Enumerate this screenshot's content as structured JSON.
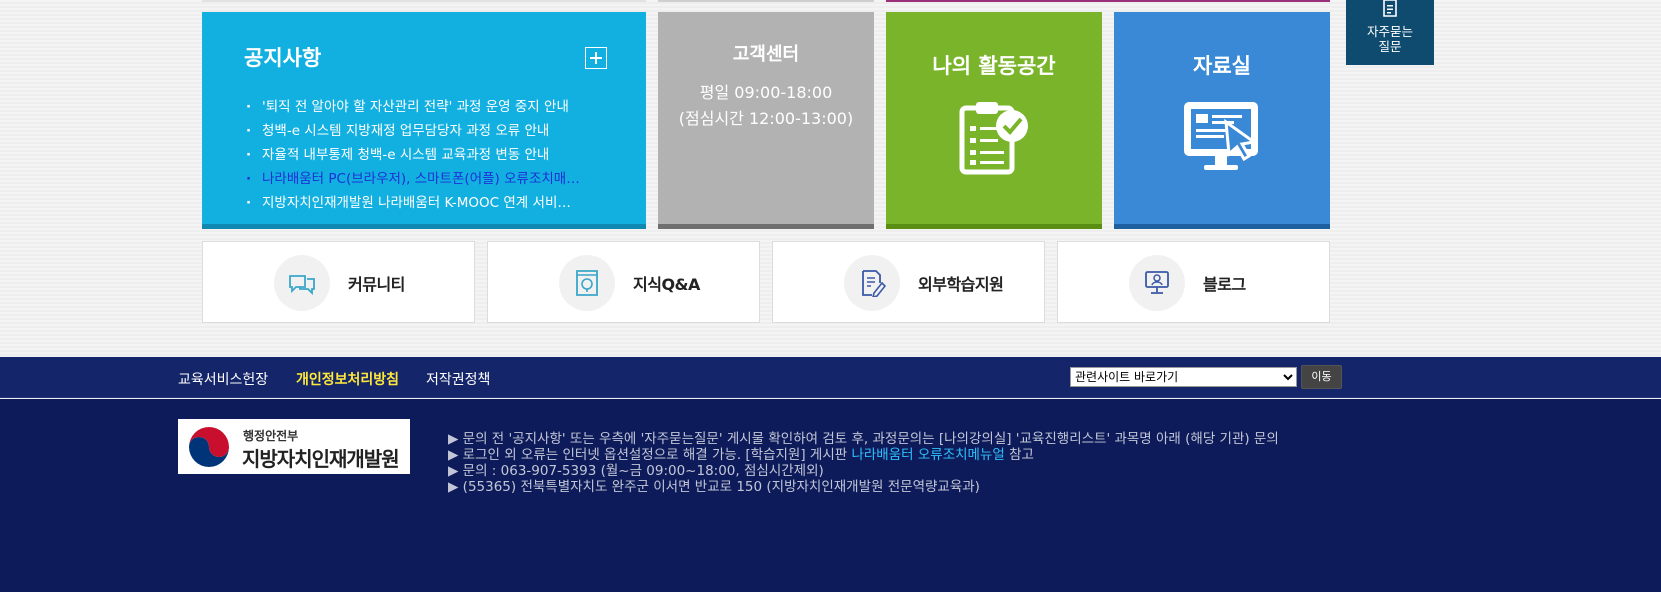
{
  "notice": {
    "title": "공지사항",
    "items": [
      "'퇴직 전 알아야 할 자산관리 전략' 과정 운영 중지 안내",
      "청백-e 시스템 지방재정 업무담당자 과정 오류 안내",
      "자율적 내부통제 청백-e 시스템 교육과정 변동 안내",
      "나라배움터 PC(브라우저), 스마트폰(어플) 오류조치매…",
      "지방자치인재개발원 나라배움터 K-MOOC 연계 서비…"
    ]
  },
  "customer": {
    "title": "고객센터",
    "hours_line1": "평일 09:00-18:00",
    "hours_line2": "(점심시간 12:00-13:00)"
  },
  "activity": {
    "title": "나의 활동공간"
  },
  "archive": {
    "title": "자료실"
  },
  "faq": {
    "label_line1": "자주묻는",
    "label_line2": "질문"
  },
  "quick_links": [
    {
      "label": "커뮤니티",
      "icon": "chat-bubbles-icon"
    },
    {
      "label": "지식Q&A",
      "icon": "knowledge-book-icon"
    },
    {
      "label": "외부학습지원",
      "icon": "document-pen-icon"
    },
    {
      "label": "블로그",
      "icon": "monitor-person-icon"
    }
  ],
  "footer_nav": {
    "links": [
      "교육서비스헌장",
      "개인정보처리방침",
      "저작권정책"
    ],
    "select_value": "관련사이트 바로가기",
    "go_label": "이동"
  },
  "footer": {
    "logo_ministry": "행정안전부",
    "logo_org": "지방자치인재개발원",
    "info1": "▶ 문의 전 '공지사항' 또는 우측에 '자주묻는질문' 게시물 확인하여 검토 후, 과정문의는 [나의강의실] '교육진행리스트' 과목명 아래 (해당 기관) 문의",
    "info2_prefix": "▶ 로그인 외 오류는 인터넷 옵션설정으로 해결 가능. [학습지원] 게시판 ",
    "info2_link": "나라배움터 오류조치메뉴얼",
    "info2_suffix": " 참고",
    "info3": "▶ 문의 : 063-907-5393 (월~금 09:00~18:00, 점심시간제외)",
    "info4": "▶ (55365) 전북특별자치도 완주군 이서면 반교로 150 (지방자치인재개발원 전문역량교육과)"
  },
  "colors": {
    "notice_bg": "#12b0e0",
    "customer_bg": "#b2b2b2",
    "activity_bg": "#7ab42a",
    "archive_bg": "#3a89d6",
    "faq_bg": "#0e4b6e",
    "footer_nav_bg": "#15256a",
    "footer_bg": "#0d1b5a",
    "privacy_highlight": "#ffe83a",
    "link_highlight": "#2fc0ff"
  }
}
